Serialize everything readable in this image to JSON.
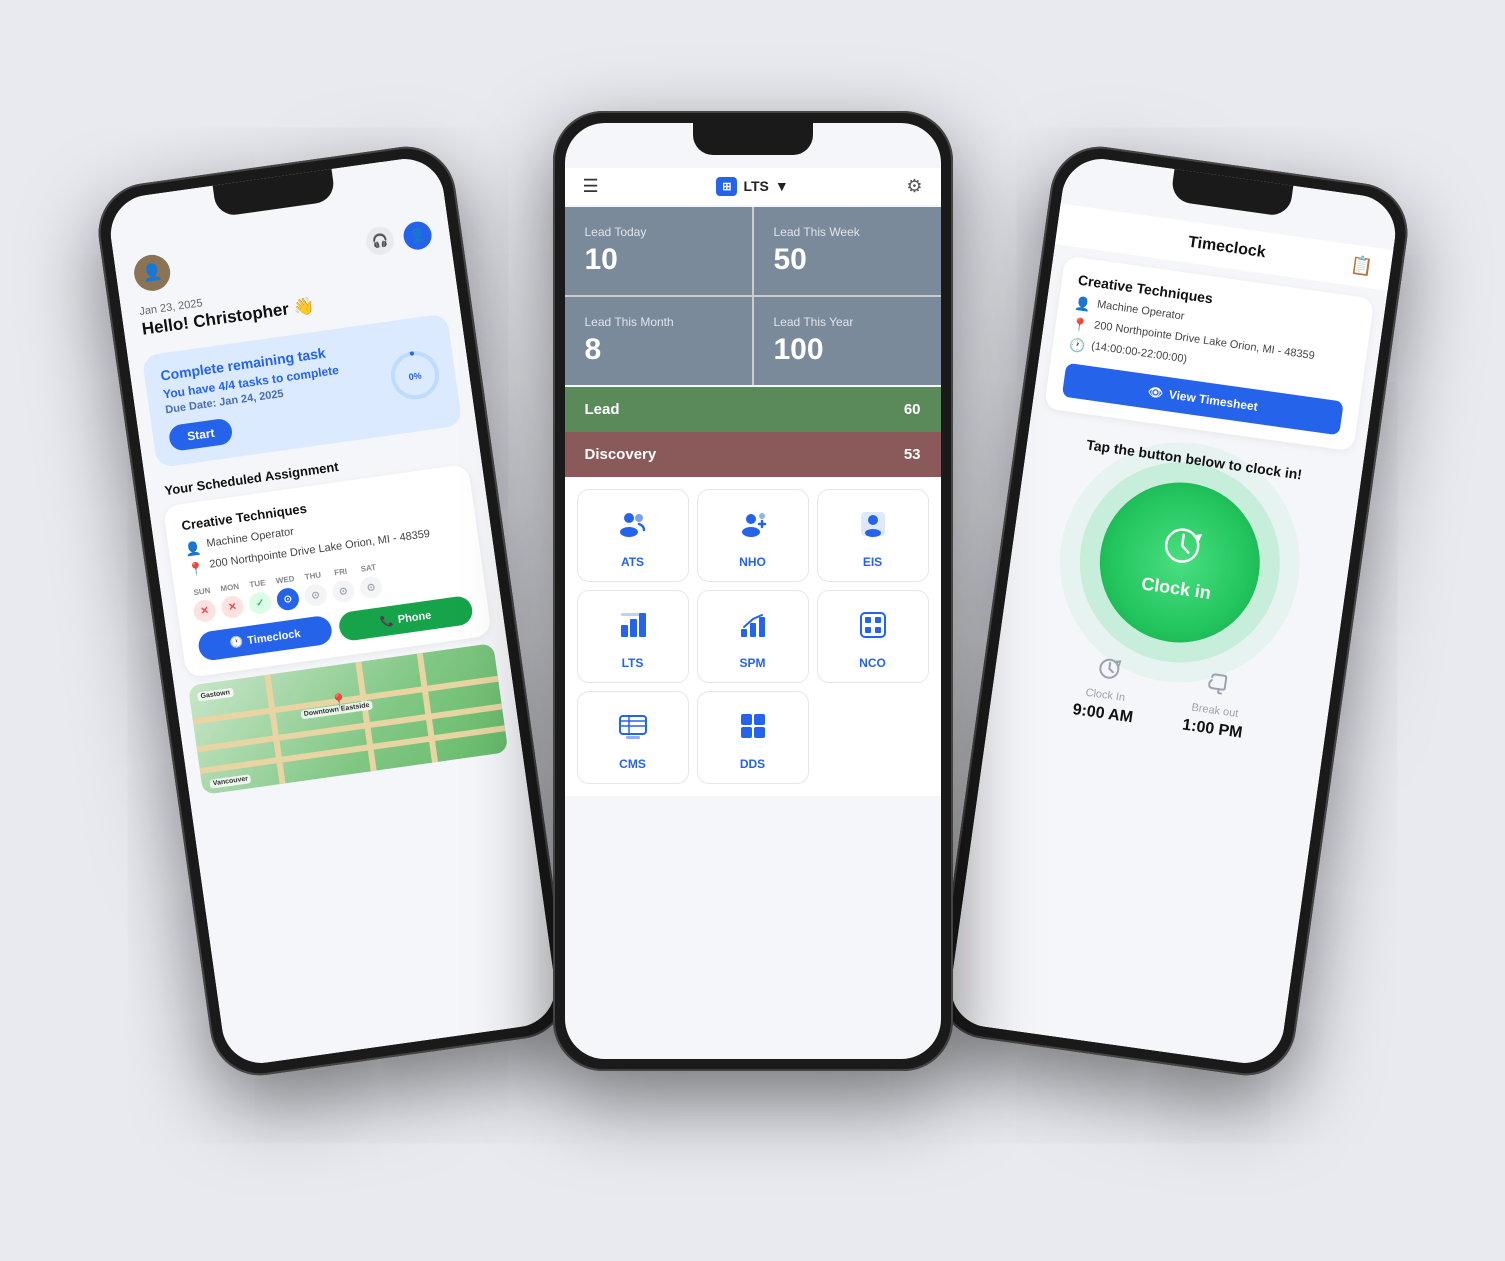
{
  "left_phone": {
    "date": "Jan 23, 2025",
    "greeting": "Hello! Christopher 👋",
    "task_card": {
      "title": "Complete remaining task",
      "subtitle": "You have 4/4 tasks to complete",
      "due_label": "Due Date: ",
      "due_date": "Jan 24, 2025",
      "start_btn": "Start",
      "progress": "0%"
    },
    "section_title": "Your Scheduled Assignment",
    "assignment": {
      "company": "Creative Techniques",
      "role": "Machine Operator",
      "address": "200 Northpointe Drive Lake Orion, MI - 48359",
      "days": [
        "SUN",
        "MON",
        "TUE",
        "WED",
        "THU",
        "FRI",
        "SAT"
      ],
      "day_states": [
        "red",
        "red",
        "green",
        "blue",
        "gray",
        "gray",
        "gray"
      ]
    },
    "btn_timeclock": "Timeclock",
    "btn_phone": "Phone",
    "map_labels": [
      "Vancouver",
      "Gastown",
      "Downtown Eastside"
    ]
  },
  "center_phone": {
    "header": {
      "logo": "LTS",
      "dropdown_arrow": "▼"
    },
    "stats": [
      {
        "label": "Lead Today",
        "value": "10"
      },
      {
        "label": "Lead This Week",
        "value": "50"
      },
      {
        "label": "Lead This Month",
        "value": "8"
      },
      {
        "label": "Lead This Year",
        "value": "100"
      }
    ],
    "pipelines": [
      {
        "label": "Lead",
        "value": "60"
      },
      {
        "label": "Discovery",
        "value": "53"
      }
    ],
    "modules": [
      {
        "icon": "👥",
        "label": "ATS"
      },
      {
        "icon": "👤",
        "label": "NHO"
      },
      {
        "icon": "🗂",
        "label": "EIS"
      },
      {
        "icon": "🏢",
        "label": "LTS"
      },
      {
        "icon": "📊",
        "label": "SPM"
      },
      {
        "icon": "🏬",
        "label": "NCO"
      },
      {
        "icon": "💬",
        "label": "CMS"
      },
      {
        "icon": "⊞",
        "label": "DDS"
      }
    ]
  },
  "right_phone": {
    "title": "Timeclock",
    "company": "Creative Techniques",
    "role": "Machine Operator",
    "address": "200 Northpointe Drive Lake Orion, MI - 48359",
    "time_range": "(14:00:00-22:00:00)",
    "view_btn": "View Timesheet",
    "clock_prompt": "Tap the button below to clock in!",
    "clock_in_label": "Clock in",
    "clock_in_label_time": "Clock In",
    "clock_in_time": "9:00 AM",
    "break_out_label": "Break out",
    "break_out_time": "1:00 PM"
  }
}
